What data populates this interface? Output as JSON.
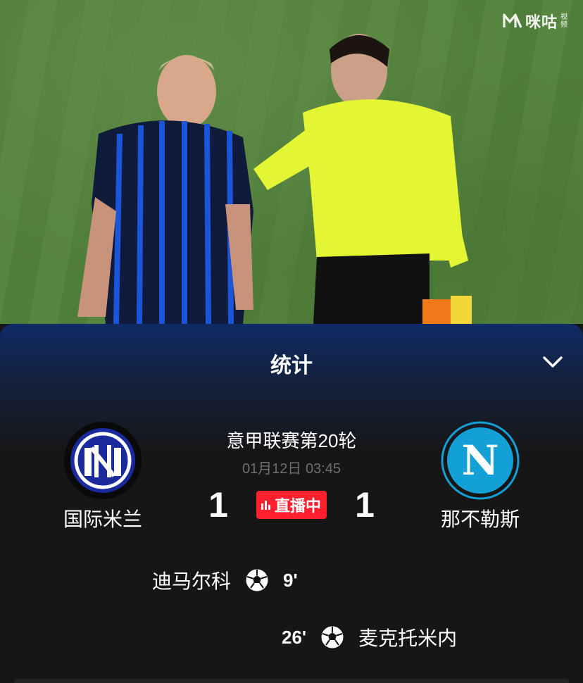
{
  "watermark": {
    "brand": "咪咕",
    "sub": "视频"
  },
  "panel": {
    "title": "统计"
  },
  "match": {
    "league_round": "意甲联赛第20轮",
    "datetime": "01月12日 03:45",
    "status": "直播中",
    "home": {
      "name": "国际米兰",
      "score": "1"
    },
    "away": {
      "name": "那不勒斯",
      "score": "1"
    }
  },
  "events": [
    {
      "side": "home",
      "player": "迪马尔科",
      "minute": "9'",
      "type": "goal"
    },
    {
      "side": "away",
      "player": "麦克托米内",
      "minute": "26'",
      "type": "goal"
    }
  ],
  "colors": {
    "live": "#ff1f2d",
    "inter": "#1a2a9c",
    "napoli": "#12a0d7",
    "panel_top": "#0f2b66"
  },
  "icons": [
    "migu-logo-icon",
    "chevron-down-icon",
    "inter-logo-icon",
    "napoli-logo-icon",
    "live-bars-icon",
    "soccer-ball-icon"
  ]
}
